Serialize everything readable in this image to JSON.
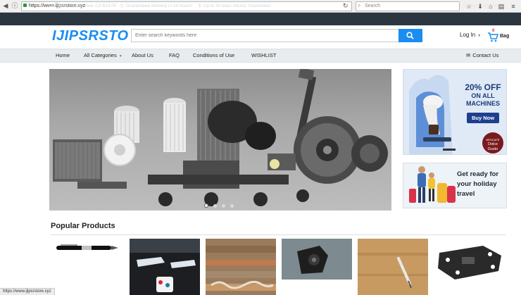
{
  "browser": {
    "url": "https://www.ijipsrstore.xyz",
    "search_placeholder": "Search",
    "status_url": "https://www.ijipsrstore.xyz"
  },
  "info_bar": {
    "items": [
      {
        "icon": "truck-icon",
        "text": "Free shipping over CA $15.00"
      },
      {
        "icon": "clock-icon",
        "text": "Guaranteed delivery in 24 hours!"
      },
      {
        "icon": "dollar-icon",
        "text": "Up to 30 days refund. Guarantee!"
      }
    ],
    "currency_label": "Currencies:",
    "currency_value": "CAD"
  },
  "header": {
    "logo_text": "IJIPSRSTO",
    "search_placeholder": "Enter search keywords here",
    "login_label": "Log In",
    "cart_count": "0",
    "cart_label": "Bag"
  },
  "nav": {
    "items": [
      {
        "label": "Home"
      },
      {
        "label": "All Categories"
      },
      {
        "label": "About Us"
      },
      {
        "label": "FAQ"
      },
      {
        "label": "Conditions of Use"
      },
      {
        "label": "WISHLIST"
      }
    ],
    "contact_label": "Contact Us"
  },
  "hero": {
    "slide_count": 4,
    "active_slide": 1
  },
  "banners": {
    "machines": {
      "line1": "20% OFF",
      "line2": "ON ALL",
      "line3": "MACHINES",
      "button": "Buy Now",
      "brand_top": "NESCAFÉ",
      "brand_main": "Dolce Gusto"
    },
    "travel": {
      "line1": "Get ready for",
      "line2": "your holiday",
      "line3": "travel"
    }
  },
  "popular": {
    "title": "Popular Products"
  },
  "colors": {
    "brand_blue": "#1a8ef0",
    "info_bar_bg": "#2b3640",
    "nav_bg": "#e9ecee",
    "banner_navy": "#1e3f8e"
  }
}
